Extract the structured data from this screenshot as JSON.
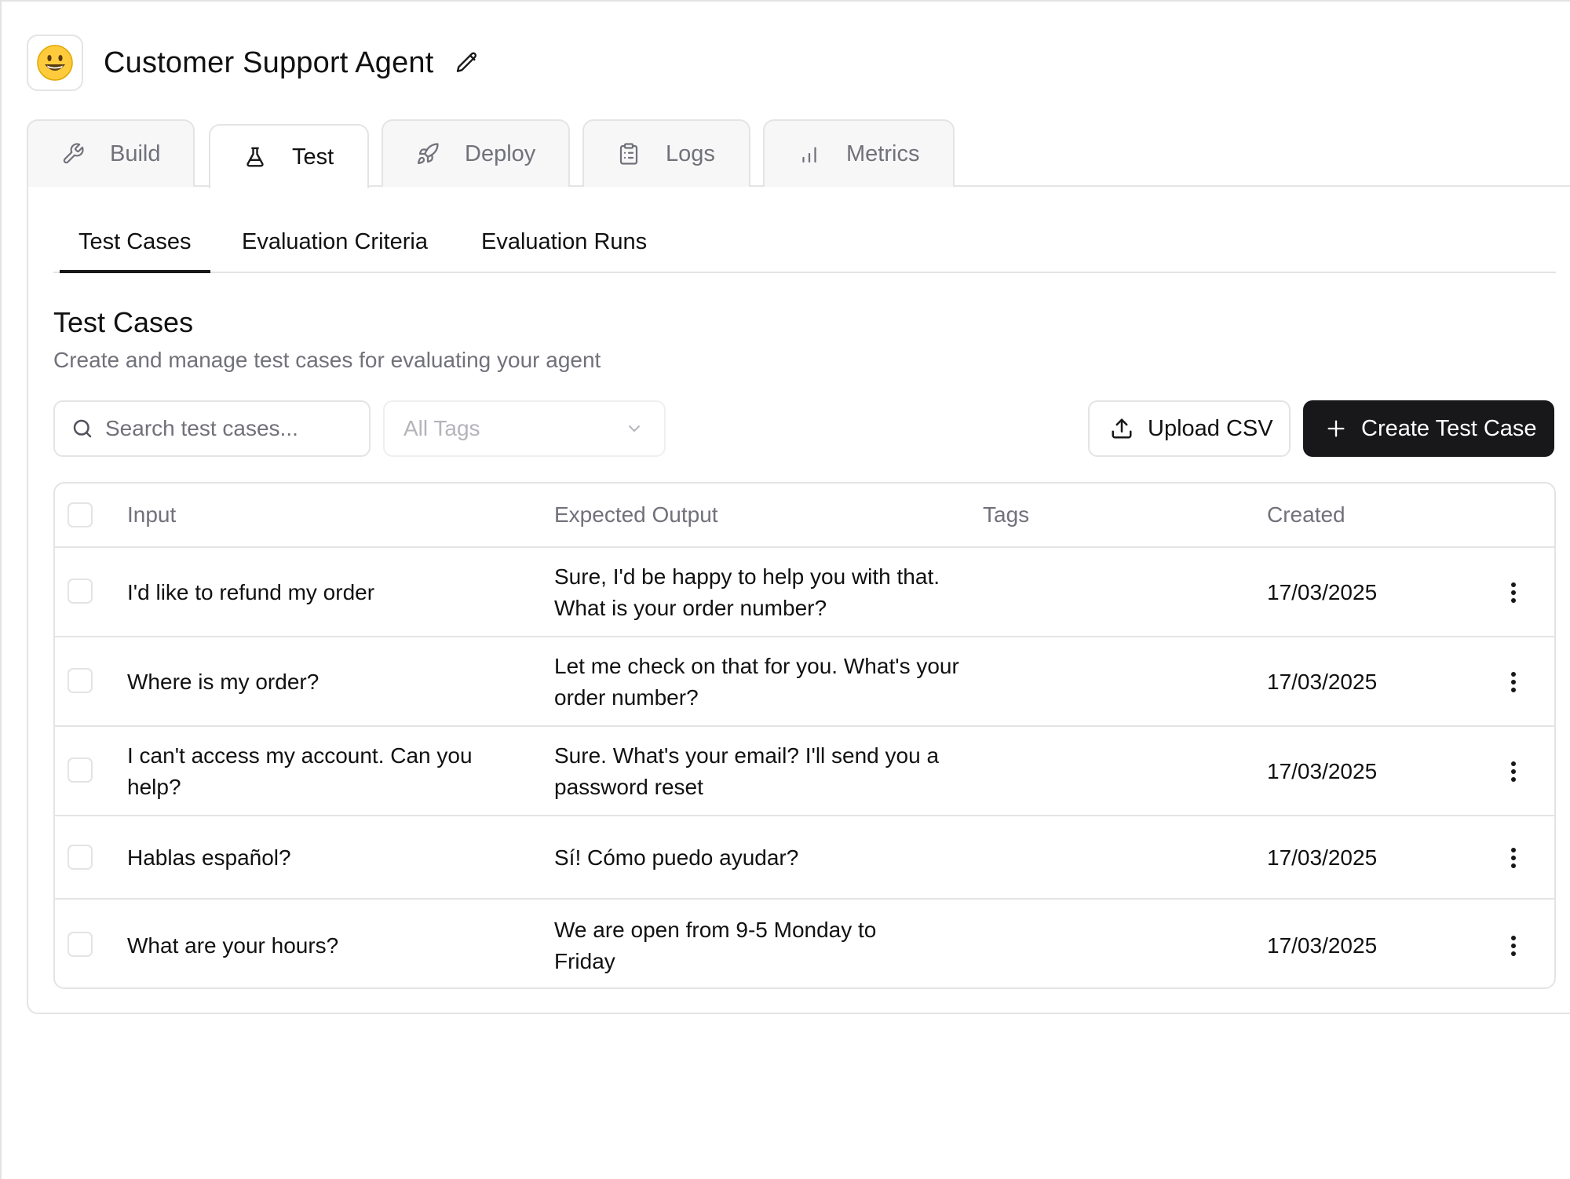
{
  "agent": {
    "emoji": "😀",
    "name": "Customer Support Agent"
  },
  "main_tabs": [
    {
      "label": "Build",
      "icon": "wrench-icon"
    },
    {
      "label": "Test",
      "icon": "flask-icon",
      "active": true
    },
    {
      "label": "Deploy",
      "icon": "rocket-icon"
    },
    {
      "label": "Logs",
      "icon": "clipboard-icon"
    },
    {
      "label": "Metrics",
      "icon": "bar-chart-icon"
    }
  ],
  "sub_tabs": [
    {
      "label": "Test Cases",
      "active": true
    },
    {
      "label": "Evaluation Criteria"
    },
    {
      "label": "Evaluation Runs"
    }
  ],
  "section": {
    "title": "Test Cases",
    "description": "Create and manage test cases for evaluating your agent"
  },
  "toolbar": {
    "search_placeholder": "Search test cases...",
    "tags_select": "All Tags",
    "upload_label": "Upload CSV",
    "create_label": "Create Test Case"
  },
  "table": {
    "columns": [
      "Input",
      "Expected Output",
      "Tags",
      "Created"
    ],
    "rows": [
      {
        "input": "I'd like to refund my order",
        "expected": "Sure, I'd be happy to help you with that. What is your order number?",
        "tags": "",
        "created": "17/03/2025"
      },
      {
        "input": "Where is my order?",
        "expected": "Let me check on that for you. What's your order number?",
        "tags": "",
        "created": "17/03/2025"
      },
      {
        "input": "I can't access my account. Can you help?",
        "expected": "Sure. What's your email? I'll send you a password reset",
        "tags": "",
        "created": "17/03/2025"
      },
      {
        "input": "Hablas español?",
        "expected": "Sí! Cómo puedo ayudar?",
        "tags": "",
        "created": "17/03/2025"
      },
      {
        "input": "What are your hours?",
        "expected": "We are open from 9-5 Monday to Friday",
        "tags": "",
        "created": "17/03/2025"
      }
    ]
  },
  "colors": {
    "primary_button": "#18181b",
    "border": "#e4e4e7",
    "muted_text": "#71717a"
  }
}
